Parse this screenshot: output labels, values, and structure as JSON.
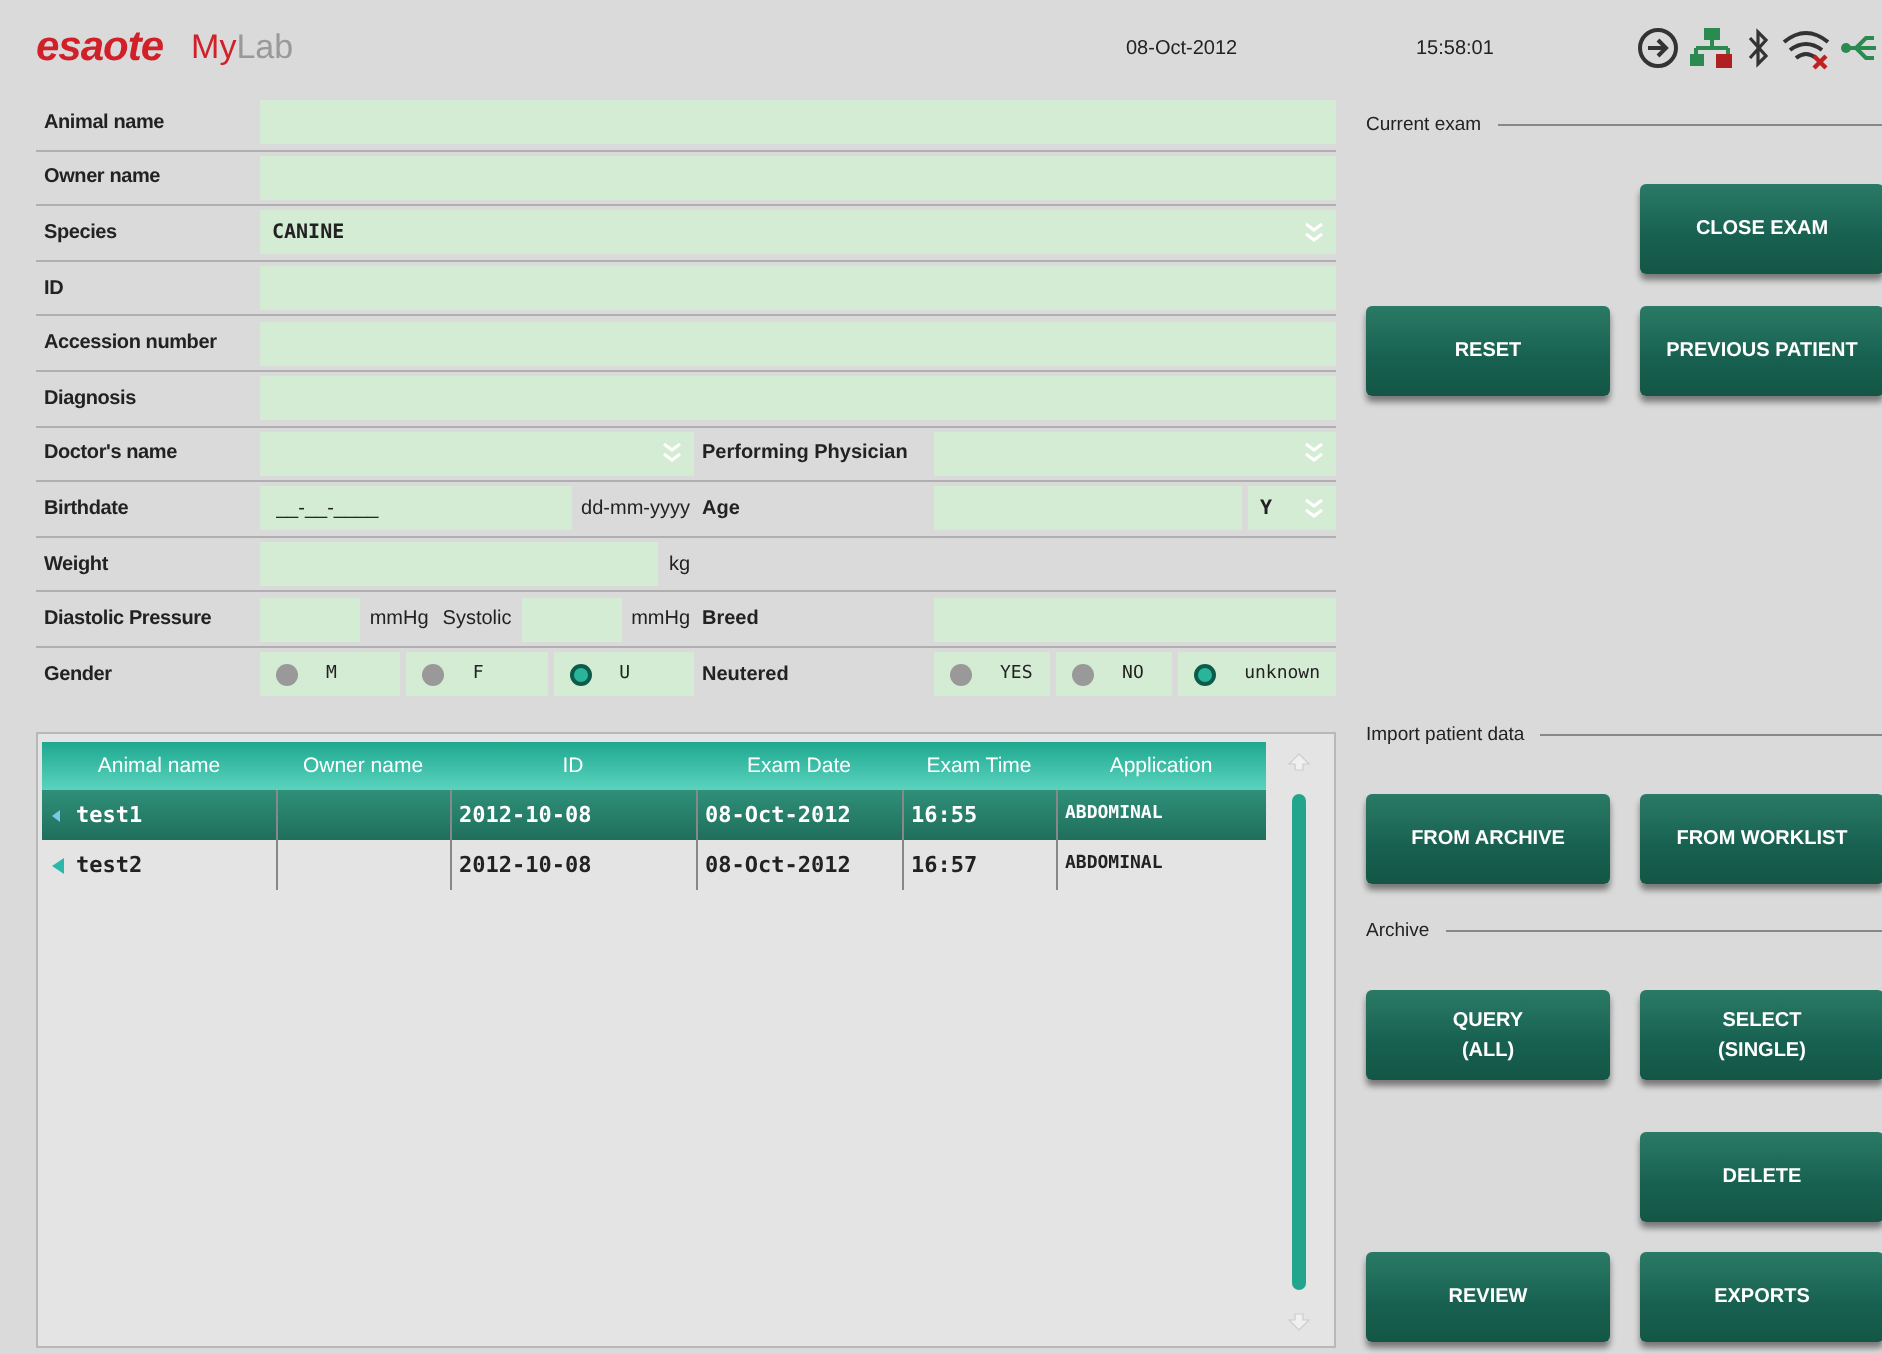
{
  "header": {
    "brand": "esaote",
    "product_prefix": "My",
    "product_suffix": "Lab",
    "date": "08-Oct-2012",
    "time": "15:58:01"
  },
  "form": {
    "rows": [
      {
        "label": "Animal name",
        "full": [
          {
            "kind": "input"
          }
        ]
      },
      {
        "label": "Owner name",
        "full": [
          {
            "kind": "input"
          }
        ]
      },
      {
        "label": "Species",
        "full": [
          {
            "kind": "select",
            "value": "CANINE"
          }
        ]
      },
      {
        "label": "ID",
        "full": [
          {
            "kind": "input"
          }
        ]
      },
      {
        "label": "Accession number",
        "full": [
          {
            "kind": "input"
          }
        ]
      },
      {
        "label": "Diagnosis",
        "full": [
          {
            "kind": "input"
          }
        ]
      },
      {
        "label": "Doctor's name",
        "left": [
          {
            "kind": "select"
          }
        ],
        "right_label": "Performing Physician",
        "right": [
          {
            "kind": "select"
          }
        ]
      },
      {
        "label": "Birthdate",
        "left": [
          {
            "kind": "input",
            "placeholder": "__-__-____"
          },
          {
            "kind": "unit",
            "text": "dd-mm-yyyy"
          }
        ],
        "right_label": "Age",
        "right": [
          {
            "kind": "input"
          },
          {
            "kind": "select",
            "value": "Y"
          }
        ]
      },
      {
        "label": "Weight",
        "left": [
          {
            "kind": "input"
          },
          {
            "kind": "unit",
            "text": "kg"
          }
        ]
      },
      {
        "label": "Diastolic Pressure",
        "left": [
          {
            "kind": "input"
          },
          {
            "kind": "unit",
            "text": "mmHg"
          },
          {
            "kind": "unit",
            "text": "Systolic"
          },
          {
            "kind": "input"
          },
          {
            "kind": "unit",
            "text": "mmHg"
          }
        ],
        "right_label": "Breed",
        "right": [
          {
            "kind": "input"
          }
        ]
      },
      {
        "label": "Gender",
        "left": [
          {
            "kind": "radio",
            "text": "M",
            "selected": false
          },
          {
            "kind": "radio",
            "text": "F",
            "selected": false
          },
          {
            "kind": "radio",
            "text": "U",
            "selected": true
          }
        ],
        "right_label": "Neutered",
        "right": [
          {
            "kind": "radio",
            "text": "YES",
            "selected": false
          },
          {
            "kind": "radio",
            "text": "NO",
            "selected": false
          },
          {
            "kind": "radio",
            "text": "unknown",
            "selected": true
          }
        ]
      }
    ]
  },
  "table": {
    "columns": [
      "Animal name",
      "Owner name",
      "ID",
      "Exam Date",
      "Exam Time",
      "Application"
    ],
    "rows": [
      {
        "selected": true,
        "cells": [
          "test1",
          null,
          "2012-10-08",
          "08-Oct-2012",
          "16:55",
          "ABDOMINAL"
        ]
      },
      {
        "selected": false,
        "cells": [
          "test2",
          null,
          "2012-10-08",
          "08-Oct-2012",
          "16:57",
          "ABDOMINAL"
        ]
      }
    ]
  },
  "panel": {
    "sections": [
      {
        "title": "Current exam",
        "rows": [
          [
            "",
            "CLOSE EXAM"
          ],
          [
            "RESET",
            "PREVIOUS PATIENT"
          ]
        ]
      },
      {
        "title": "Import patient data",
        "rows": [
          [
            "FROM ARCHIVE",
            "FROM WORKLIST"
          ]
        ]
      },
      {
        "title": "Archive",
        "rows": [
          [
            "QUERY\n(ALL)",
            "SELECT\n(SINGLE)"
          ]
        ]
      }
    ],
    "footer_rows": [
      [
        "",
        "DELETE"
      ],
      [
        "REVIEW",
        "EXPORTS"
      ]
    ]
  }
}
